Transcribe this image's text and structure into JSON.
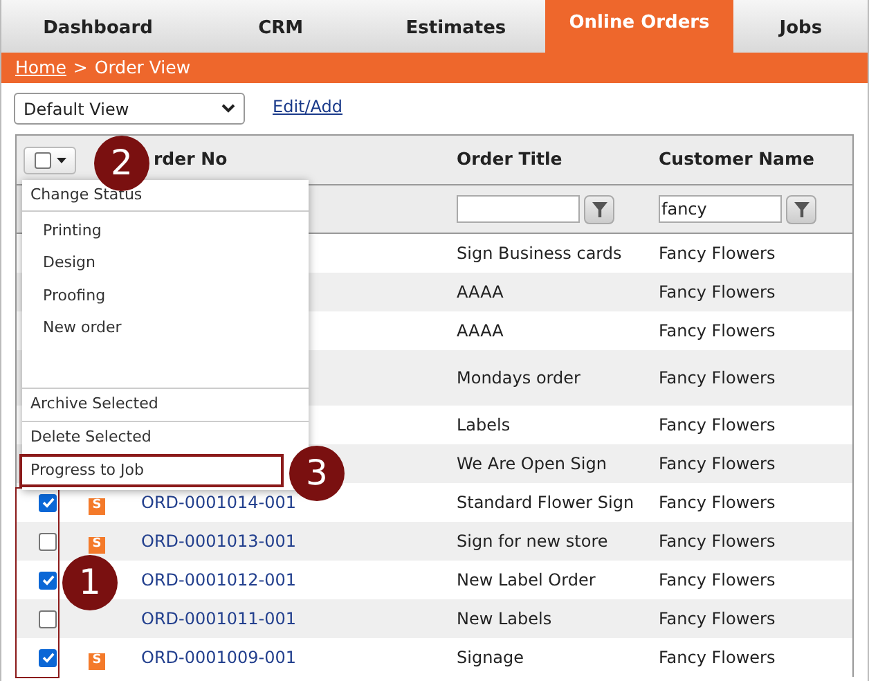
{
  "tabs": [
    {
      "label": "Dashboard",
      "selected": false
    },
    {
      "label": "CRM",
      "selected": false
    },
    {
      "label": "Estimates",
      "selected": false
    },
    {
      "label": "Online Orders",
      "selected": true
    },
    {
      "label": "Jobs",
      "selected": false
    }
  ],
  "breadcrumb": {
    "home": "Home",
    "separator": ">",
    "current": "Order View"
  },
  "view_select": {
    "value": "Default View"
  },
  "edit_link": "Edit/Add",
  "table": {
    "columns": [
      {
        "label": "rder No",
        "filter": false
      },
      {
        "label": "Order Title",
        "filter": true
      },
      {
        "label": "Customer Name",
        "filter": true,
        "filter_value": "fancy"
      }
    ],
    "rows": [
      {
        "title": "Sign Business cards",
        "customer": "Fancy Flowers"
      },
      {
        "title": "AAAA",
        "customer": "Fancy Flowers"
      },
      {
        "title": "AAAA",
        "customer": "Fancy Flowers"
      },
      {
        "title": "Mondays order",
        "customer": "Fancy Flowers",
        "tall": true
      },
      {
        "title": "Labels",
        "customer": "Fancy Flowers"
      },
      {
        "title": "We Are Open Sign",
        "customer": "Fancy Flowers"
      },
      {
        "checked": true,
        "badge": "S",
        "order_no": "ORD-0001014-001",
        "title": "Standard Flower Sign",
        "customer": "Fancy Flowers"
      },
      {
        "checked": false,
        "badge": "S",
        "order_no": "ORD-0001013-001",
        "title": "Sign for new store",
        "customer": "Fancy Flowers"
      },
      {
        "checked": true,
        "order_no": "ORD-0001012-001",
        "title": "New Label Order",
        "customer": "Fancy Flowers"
      },
      {
        "checked": false,
        "order_no": "ORD-0001011-001",
        "title": "New Labels",
        "customer": "Fancy Flowers"
      },
      {
        "checked": true,
        "badge": "S",
        "order_no": "ORD-0001009-001",
        "title": "Signage",
        "customer": "Fancy Flowers"
      }
    ]
  },
  "select_all": {
    "checked": false
  },
  "menu": {
    "header": "Change Status",
    "statuses": [
      "Printing",
      "Design",
      "Proofing",
      "New order"
    ],
    "actions": [
      {
        "label": "Archive Selected",
        "highlighted": false
      },
      {
        "label": "Delete Selected",
        "highlighted": false
      },
      {
        "label": "Progress to Job",
        "highlighted": true
      }
    ]
  },
  "callouts": [
    "1",
    "2",
    "3"
  ]
}
